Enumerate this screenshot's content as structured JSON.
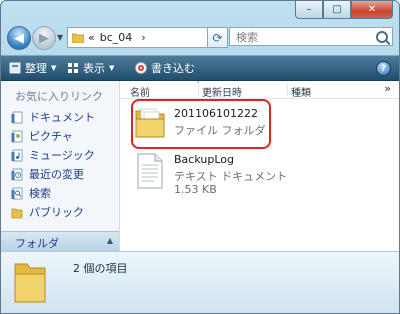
{
  "window": {
    "caption_buttons": {
      "minimize": "–",
      "maximize": "□",
      "close": "✕"
    }
  },
  "address_bar": {
    "overflow": "«",
    "path": [
      "bc_04"
    ],
    "separator": "›",
    "search_placeholder": "検索"
  },
  "toolbar": {
    "organize_label": "整理",
    "views_label": "表示",
    "burn_label": "書き込む",
    "help": "?"
  },
  "nav_pane": {
    "header": "お気に入りリンク",
    "items": [
      {
        "label": "ドキュメント",
        "icon": "documents-icon"
      },
      {
        "label": "ピクチャ",
        "icon": "pictures-icon"
      },
      {
        "label": "ミュージック",
        "icon": "music-icon"
      },
      {
        "label": "最近の変更",
        "icon": "recent-changes-icon"
      },
      {
        "label": "検索",
        "icon": "search-folder-icon"
      },
      {
        "label": "パブリック",
        "icon": "public-folder-icon"
      }
    ],
    "folders_label": "フォルダ"
  },
  "file_list": {
    "columns": [
      "名前",
      "更新日時",
      "種類"
    ],
    "more": "»",
    "items": [
      {
        "name": "201106101222",
        "type": "ファイル フォルダ",
        "size": "",
        "icon": "folder-icon"
      },
      {
        "name": "BackupLog",
        "type": "テキスト ドキュメント",
        "size": "1.53 KB",
        "icon": "text-document-icon"
      }
    ]
  },
  "details_pane": {
    "item_count": "2 個の項目"
  },
  "colors": {
    "toolbar": "#2f5f80",
    "highlight": "#e02424",
    "link": "#1e3e8c"
  }
}
